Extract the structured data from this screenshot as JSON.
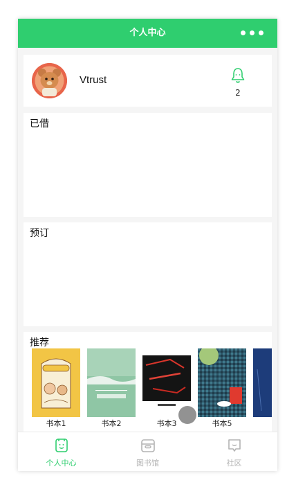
{
  "navbar": {
    "title": "个人中心"
  },
  "profile": {
    "username": "Vtrust",
    "notification_count": "2"
  },
  "sections": {
    "borrowed_title": "已借",
    "reserved_title": "预订",
    "recommend_title": "推荐"
  },
  "recommend": {
    "books": [
      {
        "title": "书本1",
        "cover_color": "#f2c545"
      },
      {
        "title": "书本2",
        "cover_color": "#8fc6a5"
      },
      {
        "title": "书本3",
        "cover_color": "#1a1a1a"
      },
      {
        "title": "书本5",
        "cover_color": "#2f5a70"
      },
      {
        "title": "",
        "cover_color": "#1d3c7a"
      }
    ]
  },
  "tabbar": {
    "items": [
      {
        "label": "个人中心",
        "active": true
      },
      {
        "label": "图书馆",
        "active": false
      },
      {
        "label": "社区",
        "active": false
      }
    ],
    "active_color": "#2fce6f",
    "inactive_color": "#b3b3b3"
  },
  "colors": {
    "brand": "#2fce6f"
  }
}
